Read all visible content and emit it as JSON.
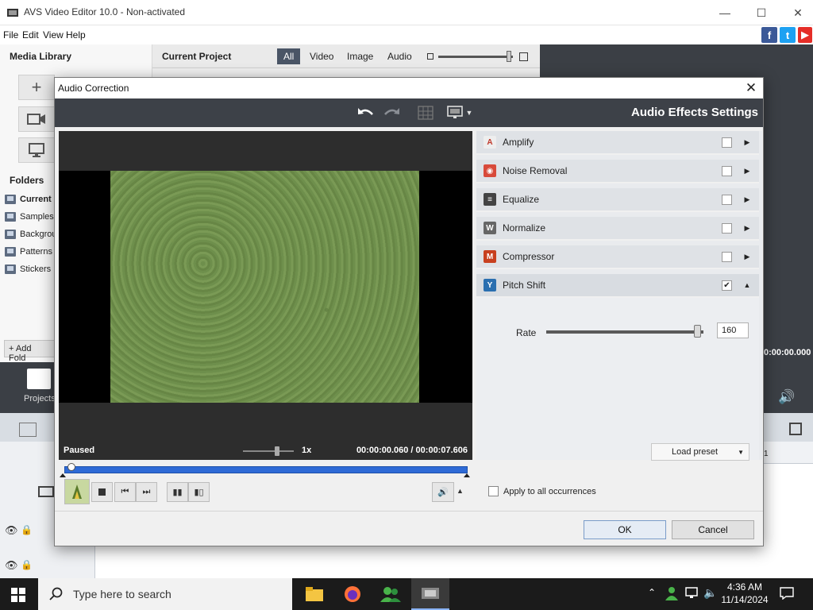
{
  "app": {
    "title": "AVS Video Editor 10.0 - Non-activated",
    "menu": [
      "File",
      "Edit",
      "View",
      "Help"
    ],
    "minimize": "—",
    "maximize": "☐",
    "close": "✕"
  },
  "media_library": {
    "title": "Media Library",
    "folders_title": "Folders",
    "folders": [
      "Current",
      "Samples",
      "Backgrou",
      "Patterns",
      "Stickers"
    ],
    "add_folder": "+ Add Fold",
    "projects_label": "Projects"
  },
  "project": {
    "title": "Current Project",
    "filters": [
      "All",
      "Video",
      "Image",
      "Audio"
    ]
  },
  "right_panel": {
    "timecode": "0:00:00.000"
  },
  "timeline": {
    "ruler_mark": "1"
  },
  "dialog": {
    "title": "Audio Correction",
    "settings_title": "Audio Effects Settings",
    "status": "Paused",
    "speed": "1x",
    "time": "00:00:00.060  /  00:00:07.606",
    "effects": [
      {
        "name": "Amplify",
        "checked": false,
        "expanded": false,
        "icon_color": "#eeeeee"
      },
      {
        "name": "Noise Removal",
        "checked": false,
        "expanded": false,
        "icon_color": "#d84a3a"
      },
      {
        "name": "Equalize",
        "checked": false,
        "expanded": false,
        "icon_color": "#444444"
      },
      {
        "name": "Normalize",
        "checked": false,
        "expanded": false,
        "icon_color": "#666666"
      },
      {
        "name": "Compressor",
        "checked": false,
        "expanded": false,
        "icon_color": "#c8401f"
      },
      {
        "name": "Pitch Shift",
        "checked": true,
        "expanded": true,
        "icon_color": "#2a6fb0"
      }
    ],
    "rate_label": "Rate",
    "rate_value": "160",
    "rate_fraction": 0.97,
    "seek_fraction": 0.008,
    "load_preset": "Load preset",
    "apply_all": "Apply to all occurrences",
    "ok": "OK",
    "cancel": "Cancel"
  },
  "taskbar": {
    "search_placeholder": "Type here to search",
    "time": "4:36 AM",
    "date": "11/14/2024"
  },
  "colors": {
    "toolbar_dark": "#3d4148",
    "seek_blue": "#2e6ad6",
    "twitter": "#1da1f2",
    "facebook": "#3b5998",
    "youtube": "#e52d27"
  }
}
